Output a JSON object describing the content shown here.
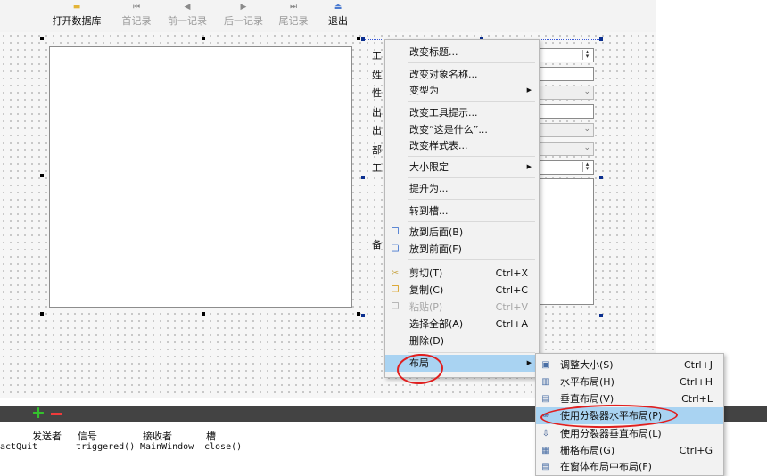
{
  "toolbar": {
    "open_db": "打开数据库",
    "first": "首记录",
    "prev": "前一记录",
    "next": "后一记录",
    "last": "尾记录",
    "exit": "退出"
  },
  "form": {
    "labels": [
      "工",
      "姓",
      "性",
      "出",
      "出",
      "部",
      "工",
      "备"
    ]
  },
  "context_menu": {
    "items": [
      {
        "label": "改变标题..."
      },
      {
        "label": "改变对象名称..."
      },
      {
        "label": "变型为"
      },
      {
        "label": "改变工具提示..."
      },
      {
        "label": "改变“这是什么”..."
      },
      {
        "label": "改变样式表..."
      },
      {
        "label": "大小限定"
      },
      {
        "label": "提升为..."
      },
      {
        "label": "转到槽..."
      },
      {
        "label": "放到后面(B)"
      },
      {
        "label": "放到前面(F)"
      },
      {
        "label": "剪切(T)",
        "shortcut": "Ctrl+X"
      },
      {
        "label": "复制(C)",
        "shortcut": "Ctrl+C"
      },
      {
        "label": "粘贴(P)",
        "shortcut": "Ctrl+V"
      },
      {
        "label": "选择全部(A)",
        "shortcut": "Ctrl+A"
      },
      {
        "label": "删除(D)"
      },
      {
        "label": "布局"
      }
    ]
  },
  "layout_submenu": {
    "items": [
      {
        "label": "调整大小(S)",
        "shortcut": "Ctrl+J"
      },
      {
        "label": "水平布局(H)",
        "shortcut": "Ctrl+H"
      },
      {
        "label": "垂直布局(V)",
        "shortcut": "Ctrl+L"
      },
      {
        "label": "使用分裂器水平布局(P)",
        "shortcut": ""
      },
      {
        "label": "使用分裂器垂直布局(L)",
        "shortcut": ""
      },
      {
        "label": "栅格布局(G)",
        "shortcut": "Ctrl+G"
      },
      {
        "label": "在窗体布局中布局(F)",
        "shortcut": ""
      }
    ]
  },
  "signal_slot": {
    "headers": [
      "发送者",
      "信号",
      "接收者",
      "槽"
    ],
    "row": [
      "actQuit",
      "triggered()",
      "MainWindow",
      "close()"
    ]
  },
  "colors": {
    "highlight": "#a9d3f2",
    "annotation": "#e01f1f",
    "plus": "#34c12d",
    "minus": "#ee3b3b"
  }
}
